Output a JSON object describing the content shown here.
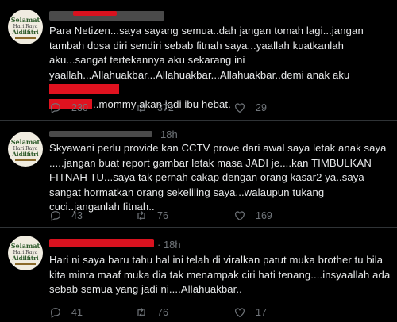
{
  "tweets": [
    {
      "name_redacted": true,
      "time": "",
      "text_parts": [
        "Para Netizen...saya sayang semua..dah jangan tomah lagi...jangan tambah dosa diri sendiri sebab fitnah saya...yaallah kuatkanlah aku...sangat tertekannya aku sekarang ini yaallah...Allahuakbar...Allahuakbar...Allahuakbar..demi anak aku ",
        "..mommy akan jadi ibu hebat."
      ],
      "replies": "230",
      "retweets": "372",
      "likes": "29"
    },
    {
      "name_redacted": true,
      "time": "18h",
      "text": "Skyawani perlu provide kan CCTV prove dari awal saya letak anak saya .....jangan buat report gambar letak masa JADI je....kan TIMBULKAN FITNAH TU...saya tak pernah cakap dengan orang kasar2 ya..saya sangat hormatkan orang sekeliling saya...walaupun tukang cuci..janganlah fitnah..",
      "replies": "43",
      "retweets": "76",
      "likes": "169"
    },
    {
      "name_redacted": true,
      "time": "· 18h",
      "text": "Hari ni saya baru tahu hal ini telah di viralkan patut muka brother tu bila kita minta maaf muka dia tak menampak ciri hati tenang....insyaallah ada sebab semua yang jadi ni....Allahuakbar..",
      "replies": "41",
      "retweets": "76",
      "likes": "17"
    }
  ],
  "avatar": {
    "line1": "Selamat",
    "line2": "Hari Raya",
    "line3": "Aidilfitri"
  },
  "icons": {
    "reply": "reply-icon",
    "retweet": "retweet-icon",
    "like": "like-icon"
  }
}
